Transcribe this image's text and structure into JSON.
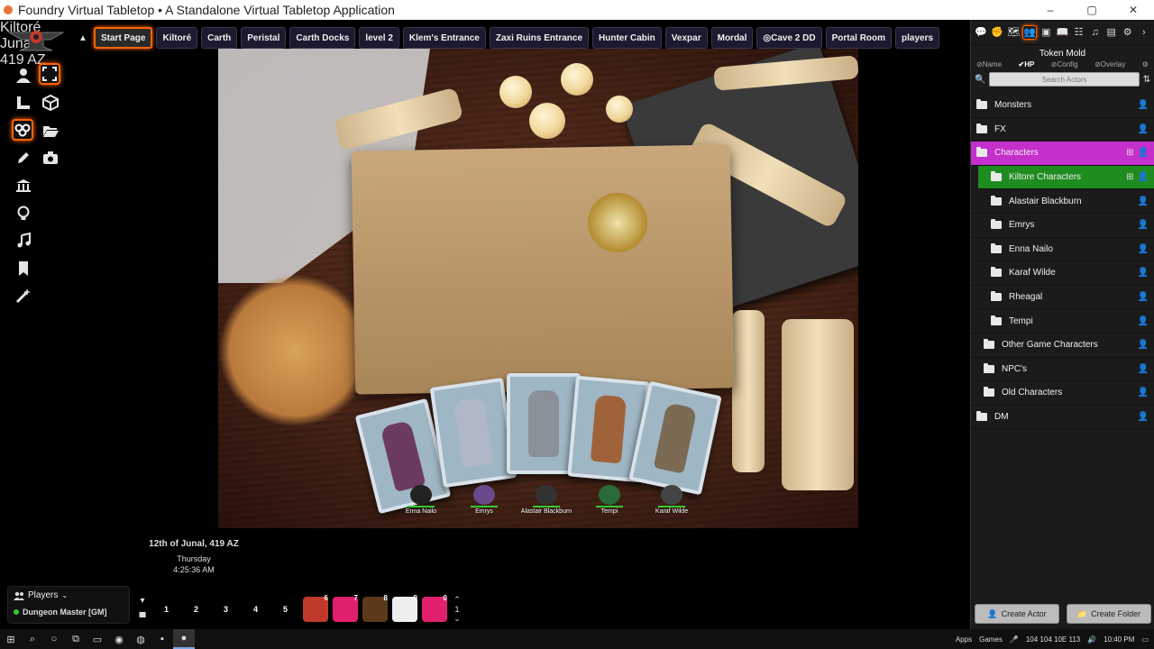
{
  "window": {
    "title": "Foundry Virtual Tabletop • A Standalone Virtual Tabletop Application",
    "minimize": "–",
    "maximize": "▢",
    "close": "✕"
  },
  "scene_nav": {
    "scenes": [
      {
        "label": "Start Page",
        "active": true
      },
      {
        "label": "Kiltoré"
      },
      {
        "label": "Carth"
      },
      {
        "label": "Peristal"
      },
      {
        "label": "Carth Docks"
      },
      {
        "label": "level 2"
      },
      {
        "label": "Klem's Entrance"
      },
      {
        "label": "Zaxi Ruins Entrance"
      },
      {
        "label": "Hunter Cabin"
      },
      {
        "label": "Vexpar"
      },
      {
        "label": "Mordal"
      },
      {
        "label": "Cave 2 DD"
      },
      {
        "label": "Portal Room"
      },
      {
        "label": "players"
      }
    ]
  },
  "scene_map": {
    "line1": "Kiltoré",
    "line2": "Junal",
    "line3": "419 AZ"
  },
  "tokens": [
    {
      "name": "Enna Nailo"
    },
    {
      "name": "Emrys"
    },
    {
      "name": "Alastair Blackburn"
    },
    {
      "name": "Tempi"
    },
    {
      "name": "Karaf Wilde"
    }
  ],
  "calendar": {
    "date": "12th of Junal, 419 AZ",
    "weekday": "Thursday",
    "time": "4:25:36 AM"
  },
  "players": {
    "header": "Players",
    "list": [
      {
        "name": "Dungeon Master [GM]"
      }
    ]
  },
  "hotbar": {
    "slots": [
      "1",
      "2",
      "3",
      "4",
      "5",
      "6",
      "7",
      "8",
      "9",
      "0"
    ],
    "page": "1"
  },
  "sidebar": {
    "module_title": "Token Mold",
    "options": [
      {
        "label": "Name",
        "on": false
      },
      {
        "label": "HP",
        "on": true
      },
      {
        "label": "Config",
        "on": false
      },
      {
        "label": "Overlay",
        "on": false
      }
    ],
    "search_placeholder": "Search Actors",
    "folders": [
      {
        "label": "Monsters",
        "depth": 0
      },
      {
        "label": "FX",
        "depth": 0
      },
      {
        "label": "Characters",
        "depth": 0,
        "highlight": "#c52fcc"
      },
      {
        "label": "Kiltore Characters",
        "depth": 1,
        "highlight": "#1f8c1f"
      },
      {
        "label": "Alastair Blackburn",
        "depth": 2
      },
      {
        "label": "Emrys",
        "depth": 2
      },
      {
        "label": "Enna Nailo",
        "depth": 2
      },
      {
        "label": "Karaf Wilde",
        "depth": 2
      },
      {
        "label": "Rheagal",
        "depth": 2
      },
      {
        "label": "Tempi",
        "depth": 2
      },
      {
        "label": "Other Game Characters",
        "depth": 1
      },
      {
        "label": "NPC's",
        "depth": 1
      },
      {
        "label": "Old Characters",
        "depth": 1
      },
      {
        "label": "DM",
        "depth": 0
      }
    ],
    "create_actor": "Create Actor",
    "create_folder": "Create Folder"
  },
  "taskbar": {
    "apps_label": "Apps",
    "games_label": "Games",
    "tray_values": "104 104 10E 113",
    "clock": "10:40 PM"
  }
}
